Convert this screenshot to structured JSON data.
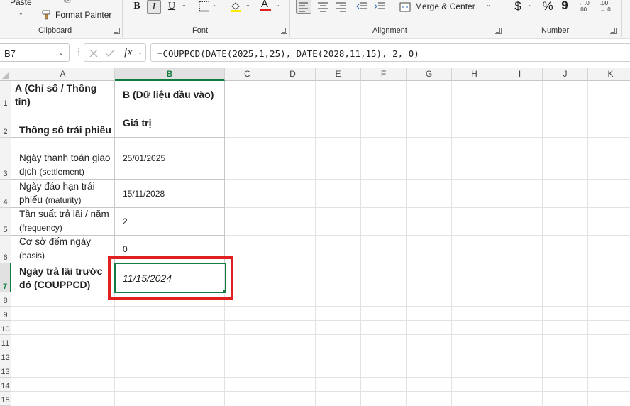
{
  "ribbon": {
    "clipboard": {
      "label": "Clipboard",
      "paste": "Paste",
      "format_painter": "Format Painter"
    },
    "font": {
      "label": "Font",
      "bold": "B",
      "italic": "I",
      "underline": "U",
      "font_color_letter": "A"
    },
    "alignment": {
      "label": "Alignment",
      "merge": "Merge & Center"
    },
    "number": {
      "label": "Number",
      "currency": "$",
      "percent": "%",
      "comma": "9",
      "inc_decimal": "←.0\n.00",
      "dec_decimal": ".00\n→.0"
    }
  },
  "formula_bar": {
    "name_box": "B7",
    "fx": "fx",
    "formula": "=COUPPCD(DATE(2025,1,25), DATE(2028,11,15), 2, 0)"
  },
  "columns": [
    "A",
    "B",
    "C",
    "D",
    "E",
    "F",
    "G",
    "H",
    "I",
    "J",
    "K"
  ],
  "rows": [
    "1",
    "2",
    "3",
    "4",
    "5",
    "6",
    "7",
    "8",
    "9",
    "10",
    "11",
    "12",
    "13",
    "14",
    "15"
  ],
  "selected": {
    "column": "B",
    "row": "7"
  },
  "cells": {
    "A1": "A (Chỉ số / Thông tin)",
    "B1": "B (Dữ liệu đầu vào)",
    "A2": "Thông số trái phiếu",
    "B2": "Giá trị",
    "A3_main": "Ngày thanh toán giao dịch",
    "A3_sub": "(settlement)",
    "B3": "25/01/2025",
    "A4_main": "Ngày đáo hạn trái phiếu",
    "A4_sub": "(maturity)",
    "B4": "15/11/2028",
    "A5_main": "Tần suất trả lãi / năm",
    "A5_sub": "(frequency)",
    "B5": "2",
    "A6_main": "Cơ sở đếm ngày",
    "A6_sub": "(basis)",
    "B6": "0",
    "A7": "Ngày trả lãi trước đó (COUPPCD)",
    "B7": "11/15/2024"
  },
  "colors": {
    "accent": "#107c41",
    "highlight": "#e02020"
  }
}
